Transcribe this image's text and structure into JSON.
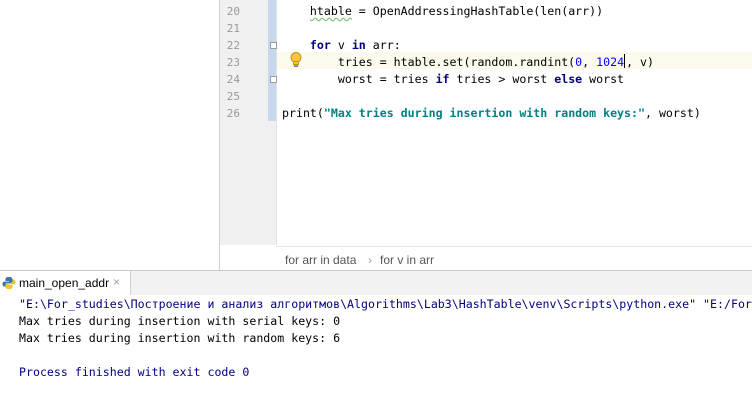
{
  "editor": {
    "line_numbers": [
      "20",
      "21",
      "22",
      "23",
      "24",
      "25",
      "26"
    ],
    "lines": {
      "l20_a": "    ",
      "l20_b": "htable",
      "l20_c": " = OpenAddressingHashTable(len(arr))",
      "l22_indent": "    ",
      "l22_for": "for",
      "l22_mid": " v ",
      "l22_in": "in",
      "l22_rest": " arr:",
      "l23_a": "        tries = htable.set(random.randint(",
      "l23_n1": "0",
      "l23_mid": ", ",
      "l23_n2a": "102",
      "l23_n2b": "4",
      "l23_end": ", v)",
      "l24_a": "        worst = tries ",
      "l24_if": "if",
      "l24_b": " tries > worst ",
      "l24_else": "else",
      "l24_c": " worst",
      "l26_a": "print(",
      "l26_str": "\"Max tries during insertion with random keys:\"",
      "l26_b": ", worst)"
    },
    "colors": {
      "keyword": "#000080",
      "number": "#0000ff",
      "string": "#008080",
      "caret_line": "#fcfaed"
    }
  },
  "breadcrumb": {
    "items": [
      "for arr in data",
      "for v in arr"
    ],
    "separator": "›"
  },
  "run_panel": {
    "tab_label": "main_open_addr",
    "tab_icon": "python-icon",
    "close_glyph": "×",
    "console_lines": [
      "\"E:\\For_studies\\Построение и анализ алгоритмов\\Algorithms\\Lab3\\HashTable\\venv\\Scripts\\python.exe\" \"E:/For",
      "Max tries during insertion with serial keys: 0",
      "Max tries during insertion with random keys: 6",
      "",
      "Process finished with exit code 0"
    ],
    "colors": {
      "command": "#000080",
      "output": "#000000",
      "process": "#000080"
    }
  }
}
